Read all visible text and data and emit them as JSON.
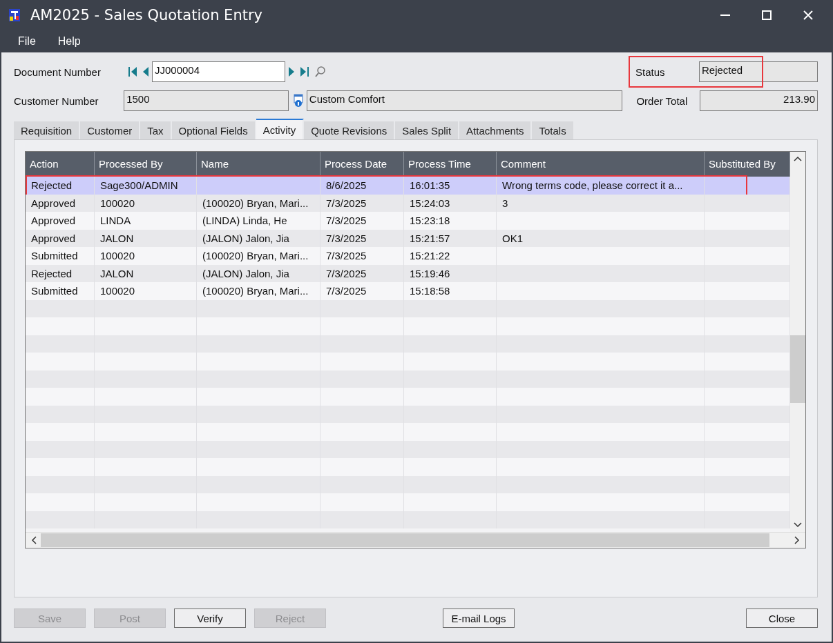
{
  "window": {
    "title": "AM2025 - Sales Quotation Entry"
  },
  "menu": [
    "File",
    "Help"
  ],
  "document_number": {
    "label": "Document Number",
    "value": "JJ000004"
  },
  "customer_number": {
    "label": "Customer Number",
    "value": "1500",
    "name": "Custom Comfort"
  },
  "status": {
    "label": "Status",
    "value": "Rejected",
    "highlighted": true
  },
  "order_total": {
    "label": "Order Total",
    "value": "213.90"
  },
  "tabs": [
    {
      "label": "Requisition",
      "selected": false
    },
    {
      "label": "Customer",
      "selected": false
    },
    {
      "label": "Tax",
      "selected": false
    },
    {
      "label": "Optional Fields",
      "selected": false
    },
    {
      "label": "Activity",
      "selected": true
    },
    {
      "label": "Quote Revisions",
      "selected": false
    },
    {
      "label": "Sales Split",
      "selected": false
    },
    {
      "label": "Attachments",
      "selected": false
    },
    {
      "label": "Totals",
      "selected": false
    }
  ],
  "table": {
    "columns": [
      "Action",
      "Processed By",
      "Name",
      "Process Date",
      "Process Time",
      "Comment",
      "Substituted By"
    ],
    "rows": [
      {
        "cells": [
          "Rejected",
          "Sage300/ADMIN",
          "",
          "8/6/2025",
          "16:01:35",
          "Wrong terms code, please correct it a...",
          ""
        ],
        "selected": true,
        "highlighted": true
      },
      {
        "cells": [
          "Approved",
          "100020",
          "(100020) Bryan, Mari...",
          "7/3/2025",
          "15:24:03",
          "3",
          ""
        ],
        "selected": false,
        "highlighted": false
      },
      {
        "cells": [
          "Approved",
          "LINDA",
          "(LINDA) Linda, He",
          "7/3/2025",
          "15:23:18",
          "",
          ""
        ],
        "selected": false,
        "highlighted": false
      },
      {
        "cells": [
          "Approved",
          "JALON",
          "(JALON) Jalon, Jia",
          "7/3/2025",
          "15:21:57",
          "OK1",
          ""
        ],
        "selected": false,
        "highlighted": false
      },
      {
        "cells": [
          "Submitted",
          "100020",
          "(100020) Bryan, Mari...",
          "7/3/2025",
          "15:21:22",
          "",
          ""
        ],
        "selected": false,
        "highlighted": false
      },
      {
        "cells": [
          "Rejected",
          "JALON",
          "(JALON) Jalon, Jia",
          "7/3/2025",
          "15:19:46",
          "",
          ""
        ],
        "selected": false,
        "highlighted": false
      },
      {
        "cells": [
          "Submitted",
          "100020",
          "(100020) Bryan, Mari...",
          "7/3/2025",
          "15:18:58",
          "",
          ""
        ],
        "selected": false,
        "highlighted": false
      }
    ]
  },
  "buttons": [
    {
      "label": "Save",
      "disabled": true
    },
    {
      "label": "Post",
      "disabled": true
    },
    {
      "label": "Verify",
      "disabled": false
    },
    {
      "label": "Reject",
      "disabled": true
    },
    {
      "label": "E-mail Logs",
      "disabled": false
    },
    {
      "label": "Close",
      "disabled": false
    }
  ]
}
